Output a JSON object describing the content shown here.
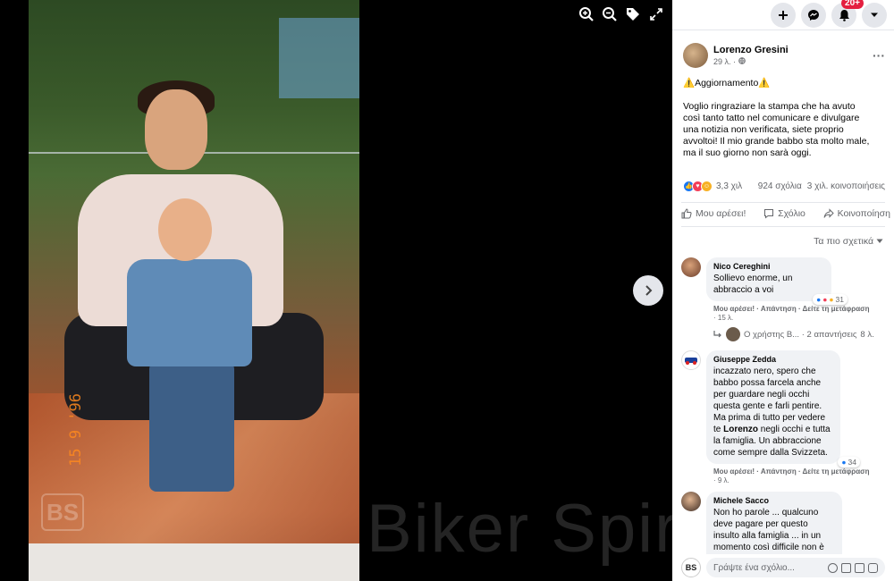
{
  "viewer": {
    "watermark": "Biker Spirit",
    "photo_logo": "BS",
    "date_stamp": "15 9 '96"
  },
  "topbar": {
    "notification_count": "20+",
    "icons": [
      "plus-icon",
      "messenger-icon",
      "bell-icon",
      "caret-down-icon"
    ]
  },
  "post": {
    "author": "Lorenzo Gresini",
    "age": "29 λ. ·",
    "title": "⚠️Aggiornamento⚠️",
    "text": "Voglio ringraziare la stampa che ha avuto così tanto tatto nel comunicare e divulgare una notizia non verificata, siete proprio avvoltoi! Il mio grande babbo sta molto male, ma il suo giorno non sarà oggi.",
    "reactions_count": "3,3 χιλ",
    "comments_count": "924 σχόλια",
    "shares_count": "3 χιλ. κοινοποιήσεις",
    "actions": {
      "like": "Μου αρέσει!",
      "comment": "Σχόλιο",
      "share": "Κοινοποίηση"
    },
    "sort_label": "Τα πιο σχετικά"
  },
  "comments": [
    {
      "name": "Nico Cereghini",
      "text": "Sollievo enorme, un abbraccio a voi",
      "reactions": "31",
      "actions": "Μου αρέσει! · Απάντηση · Δείτε τη μετάφραση",
      "age": "· 15 λ.",
      "reply_preview": "Ο χρήστης Β... · 2 απαντήσεις",
      "reply_age": "8 λ."
    },
    {
      "name": "Giuseppe Zedda",
      "text_before": "incazzato nero, spero che babbo possa farcela anche per guardare negli occhi questa gente e farli pentire. Ma prima di tutto per vedere te ",
      "text_bold": "Lorenzo",
      "text_after": " negli occhi e tutta la famiglia. Un abbraccione come sempre dalla Svizzeta.",
      "reactions": "34",
      "actions": "Μου αρέσει! · Απάντηση · Δείτε τη μετάφραση",
      "age": "· 9 λ."
    },
    {
      "name": "Michele Sacco",
      "text": "Non ho parole ... qualcuno deve pagare per questo insulto alla famiglia ... in un momento così difficile non è possibile che venga fuori una voce diffamatoria ... la notizia ha fatto il giro di mezzo mondo in"
    }
  ],
  "composer": {
    "avatar": "BS",
    "placeholder": "Γράψτε ένα σχόλιο..."
  }
}
